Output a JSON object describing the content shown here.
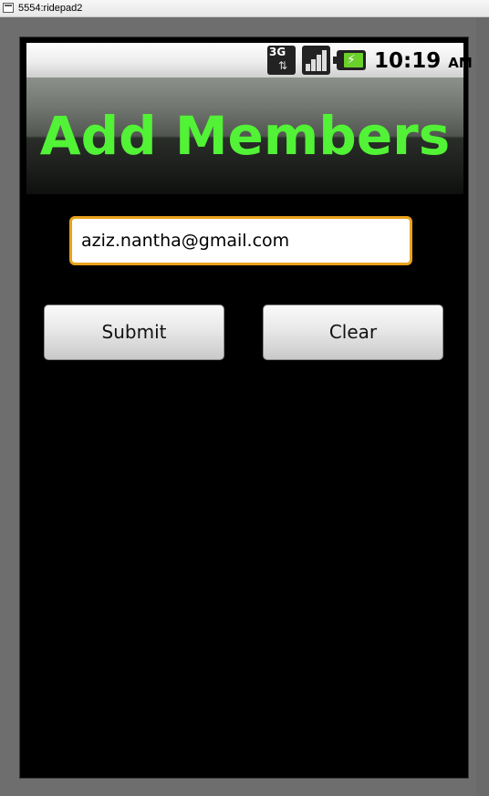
{
  "window": {
    "title": "5554:ridepad2",
    "icon": "window-app-icon"
  },
  "status_bar": {
    "network_label": "3G",
    "network_arrows": "⇅",
    "time": "10:19",
    "ampm": "AM",
    "icons": [
      "network-3g-icon",
      "signal-strength-icon",
      "battery-charging-icon"
    ]
  },
  "app": {
    "title": "Add Members",
    "title_color": "#52f236"
  },
  "form": {
    "email_value": "aziz.nantha@gmail.com",
    "submit_label": "Submit",
    "clear_label": "Clear",
    "focus_color": "#e8a21a"
  }
}
